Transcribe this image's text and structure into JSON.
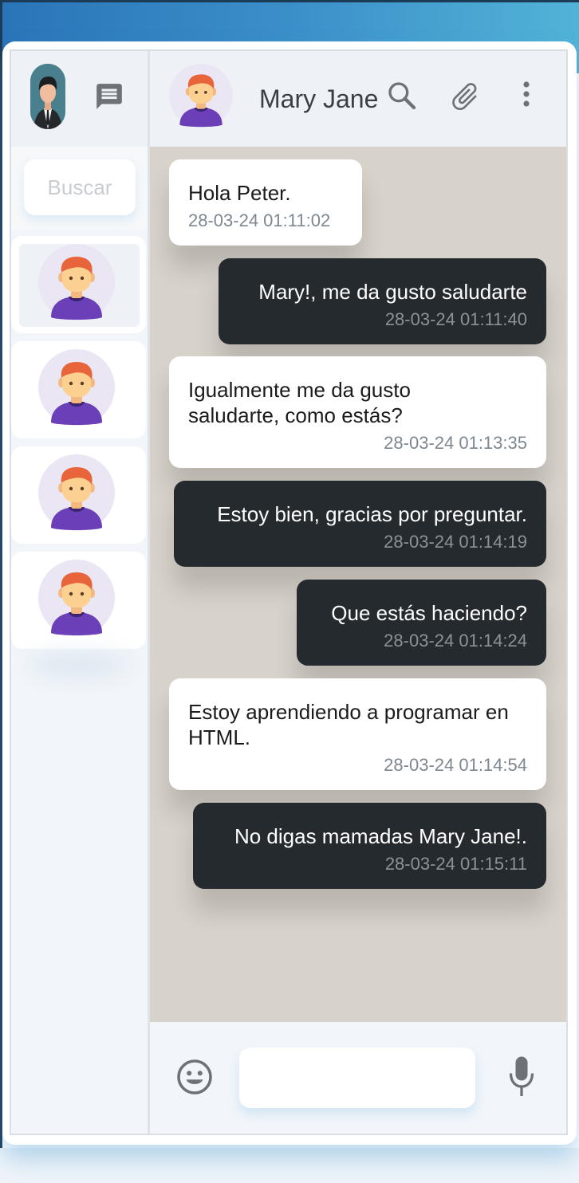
{
  "app": {
    "user_avatar_icon": "businessman-avatar-icon",
    "new_chat_icon": "chat-message-icon"
  },
  "search": {
    "placeholder": "Buscar"
  },
  "contacts": [
    {
      "avatar_icon": "redhead-boy-avatar-icon",
      "active": true
    },
    {
      "avatar_icon": "redhead-boy-avatar-icon",
      "active": false
    },
    {
      "avatar_icon": "redhead-boy-avatar-icon",
      "active": false
    },
    {
      "avatar_icon": "redhead-boy-avatar-icon",
      "active": false
    }
  ],
  "chat_header": {
    "name": "Mary Jane",
    "icons": [
      "search-icon",
      "attachment-icon",
      "more-vertical-icon"
    ]
  },
  "messages": [
    {
      "direction": "in",
      "text": "Hola Peter.",
      "time": "28-03-24 01:11:02"
    },
    {
      "direction": "out",
      "text": "Mary!, me da gusto saludarte",
      "time": "28-03-24 01:11:40"
    },
    {
      "direction": "in",
      "text": "Igualmente me da gusto saludarte, como estás?",
      "time": "28-03-24 01:13:35"
    },
    {
      "direction": "out",
      "text": "Estoy bien, gracias por preguntar.",
      "time": "28-03-24 01:14:19"
    },
    {
      "direction": "out",
      "text": "Que estás haciendo?",
      "time": "28-03-24 01:14:24"
    },
    {
      "direction": "in",
      "text": "Estoy aprendiendo a programar en HTML.",
      "time": "28-03-24 01:14:54"
    },
    {
      "direction": "out",
      "text": "No digas mamadas Mary Jane!.",
      "time": "28-03-24 01:15:11"
    }
  ],
  "composer": {
    "emoji_icon": "smiley-icon",
    "message_value": "",
    "mic_icon": "microphone-icon"
  },
  "colors": {
    "incoming_bubble": "#ffffff",
    "outgoing_bubble": "#252a2e",
    "chat_background": "#d7d2ca",
    "panel_background": "#f2f6fa",
    "avatar_shirt": "#6b3fb8",
    "avatar_hair": "#e8643a"
  }
}
